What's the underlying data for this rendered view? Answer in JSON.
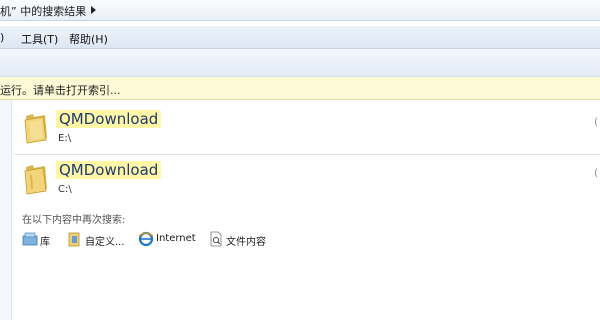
{
  "address_bar": {
    "breadcrumb_text": "机” 中的搜索结果"
  },
  "menu": {
    "items": [
      ")",
      "工具(T)",
      "帮助(H)"
    ]
  },
  "info_bar": {
    "text": "运行。请单击打开索引..."
  },
  "results": [
    {
      "name": "QMDownload",
      "path": "E:\\"
    },
    {
      "name": "QMDownload",
      "path": "C:\\"
    }
  ],
  "search_again": {
    "title": "在以下内容中再次搜索:",
    "options": [
      {
        "label": "库",
        "icon": "library-icon"
      },
      {
        "label": "自定义...",
        "icon": "custom-folder-icon"
      },
      {
        "label": "Internet",
        "icon": "internet-explorer-icon"
      },
      {
        "label": "文件内容",
        "icon": "file-contents-icon"
      }
    ]
  },
  "colors": {
    "highlight": "#fff6a6",
    "info_bar": "#fdf8d6",
    "link_blue": "#1e3a70"
  }
}
